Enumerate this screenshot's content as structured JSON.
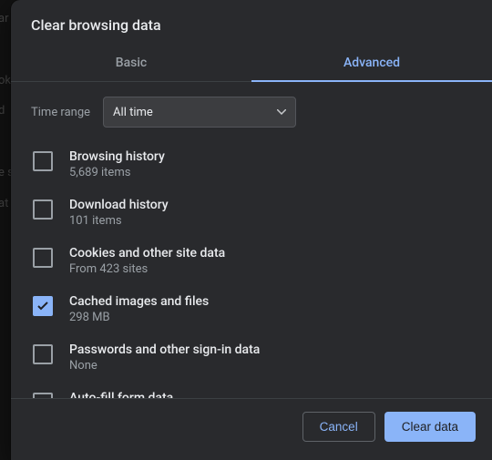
{
  "dialog": {
    "title": "Clear browsing data",
    "tabs": {
      "basic": "Basic",
      "advanced": "Advanced"
    },
    "time": {
      "label": "Time range",
      "value": "All time"
    },
    "items": [
      {
        "title": "Browsing history",
        "sub": "5,689 items",
        "checked": false
      },
      {
        "title": "Download history",
        "sub": "101 items",
        "checked": false
      },
      {
        "title": "Cookies and other site data",
        "sub": "From 423 sites",
        "checked": false
      },
      {
        "title": "Cached images and files",
        "sub": "298 MB",
        "checked": true
      },
      {
        "title": "Passwords and other sign-in data",
        "sub": "None",
        "checked": false
      },
      {
        "title": "Auto-fill form data",
        "sub": "",
        "checked": false
      }
    ],
    "buttons": {
      "cancel": "Cancel",
      "confirm": "Clear data"
    }
  }
}
